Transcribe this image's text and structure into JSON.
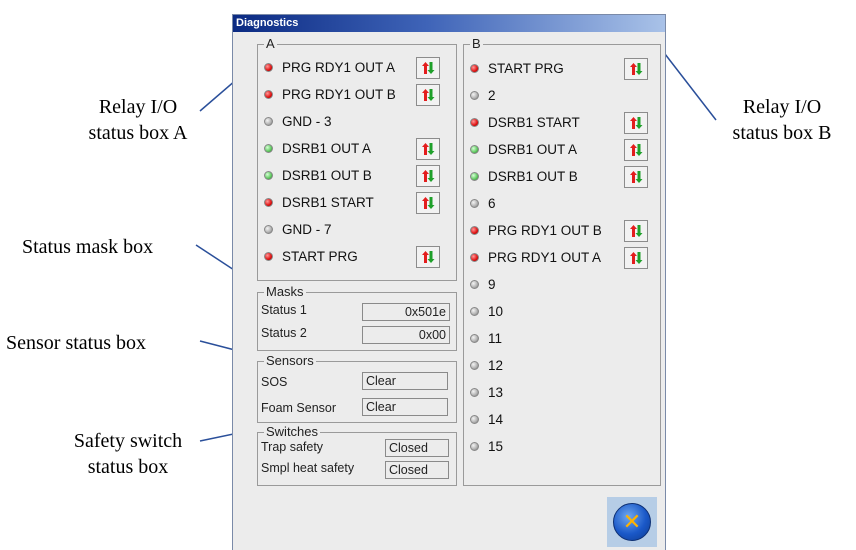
{
  "window": {
    "title": "Diagnostics"
  },
  "callouts": {
    "relay_a": [
      "Relay I/O",
      "status box A"
    ],
    "relay_b": [
      "Relay I/O",
      "status box B"
    ],
    "mask": [
      "Status mask box"
    ],
    "sensor": [
      "Sensor status box"
    ],
    "safety": [
      "Safety switch",
      "status box"
    ]
  },
  "group_a": {
    "legend": "A",
    "rows": [
      {
        "label": "PRG RDY1 OUT A",
        "led": "red",
        "toggle": true
      },
      {
        "label": "PRG RDY1 OUT B",
        "led": "red",
        "toggle": true
      },
      {
        "label": "GND - 3",
        "led": "gray",
        "toggle": false
      },
      {
        "label": "DSRB1 OUT A",
        "led": "green",
        "toggle": true
      },
      {
        "label": "DSRB1 OUT B",
        "led": "green",
        "toggle": true
      },
      {
        "label": "DSRB1 START",
        "led": "red",
        "toggle": true
      },
      {
        "label": "GND - 7",
        "led": "gray",
        "toggle": false
      },
      {
        "label": "START PRG",
        "led": "red",
        "toggle": true
      }
    ]
  },
  "group_b": {
    "legend": "B",
    "rows": [
      {
        "label": "START PRG",
        "led": "red",
        "toggle": true
      },
      {
        "label": "2",
        "led": "gray",
        "toggle": false
      },
      {
        "label": "DSRB1 START",
        "led": "red",
        "toggle": true
      },
      {
        "label": "DSRB1 OUT A",
        "led": "green",
        "toggle": true
      },
      {
        "label": "DSRB1 OUT B",
        "led": "green",
        "toggle": true
      },
      {
        "label": "6",
        "led": "gray",
        "toggle": false
      },
      {
        "label": "PRG RDY1 OUT B",
        "led": "red",
        "toggle": true
      },
      {
        "label": "PRG RDY1 OUT A",
        "led": "red",
        "toggle": true
      },
      {
        "label": "9",
        "led": "gray",
        "toggle": false
      },
      {
        "label": "10",
        "led": "gray",
        "toggle": false
      },
      {
        "label": "11",
        "led": "gray",
        "toggle": false
      },
      {
        "label": "12",
        "led": "gray",
        "toggle": false
      },
      {
        "label": "13",
        "led": "gray",
        "toggle": false
      },
      {
        "label": "14",
        "led": "gray",
        "toggle": false
      },
      {
        "label": "15",
        "led": "gray",
        "toggle": false
      }
    ]
  },
  "masks": {
    "legend": "Masks",
    "status1_label": "Status 1",
    "status1_value": "0x501e",
    "status2_label": "Status 2",
    "status2_value": "0x00"
  },
  "sensors": {
    "legend": "Sensors",
    "sos_label": "SOS",
    "sos_value": "Clear",
    "foam_label": "Foam Sensor",
    "foam_value": "Clear"
  },
  "switches": {
    "legend": "Switches",
    "trap_label": "Trap safety",
    "trap_value": "Closed",
    "smpl_label": "Smpl heat safety",
    "smpl_value": "Closed"
  },
  "colors": {
    "led_red": "#e01010",
    "led_green": "#5ec85e",
    "led_gray": "#b0b0b0",
    "close_x": "#ffb300"
  }
}
